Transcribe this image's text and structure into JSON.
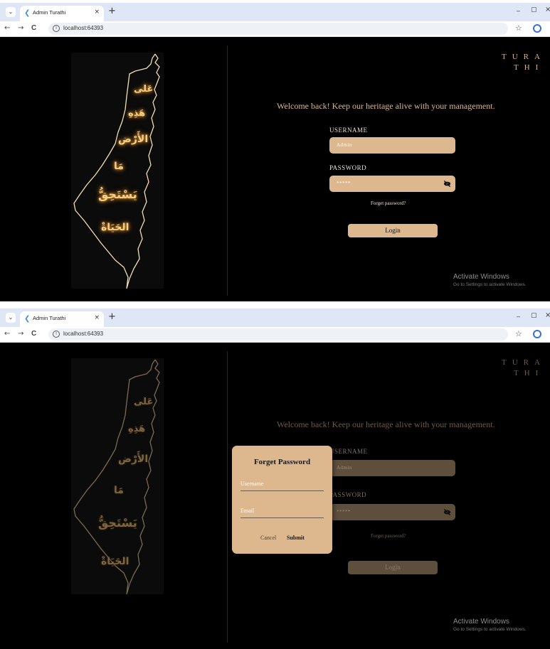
{
  "browser": {
    "tab_title": "Admin Turathi",
    "tab_close": "×",
    "new_tab": "+",
    "url": "localhost:64393",
    "window_min": "–",
    "window_max": "▢",
    "window_close": "×",
    "back": "←",
    "forward": "→",
    "reload": "C",
    "star": "☆"
  },
  "map": {
    "verse_lines": [
      "عَلى",
      "هَذِهِ",
      "الأَرْض",
      "مَا",
      "يَسْتَحِقُّ",
      "الحَيَاةْ"
    ]
  },
  "brand": {
    "line1": "TURA",
    "line2": "THI"
  },
  "login": {
    "welcome": "Welcome back! Keep our heritage alive with your management.",
    "username_label": "USERNAME",
    "username_value": "Admin",
    "password_label": "PASSWORD",
    "password_value": "*****",
    "forgot_link": "Forget password?",
    "login_button": "Login"
  },
  "dialog": {
    "title": "Forget Password",
    "username_placeholder": "Username",
    "email_placeholder": "Email",
    "cancel": "Cancel",
    "submit": "Submit"
  },
  "os_watermark": {
    "title": "Activate Windows",
    "subtitle": "Go to Settings to activate Windows."
  },
  "colors": {
    "accent": "#ddb88f",
    "background": "#000000",
    "glow": "#f7cf83",
    "map_outline": "#f2dfb2"
  }
}
